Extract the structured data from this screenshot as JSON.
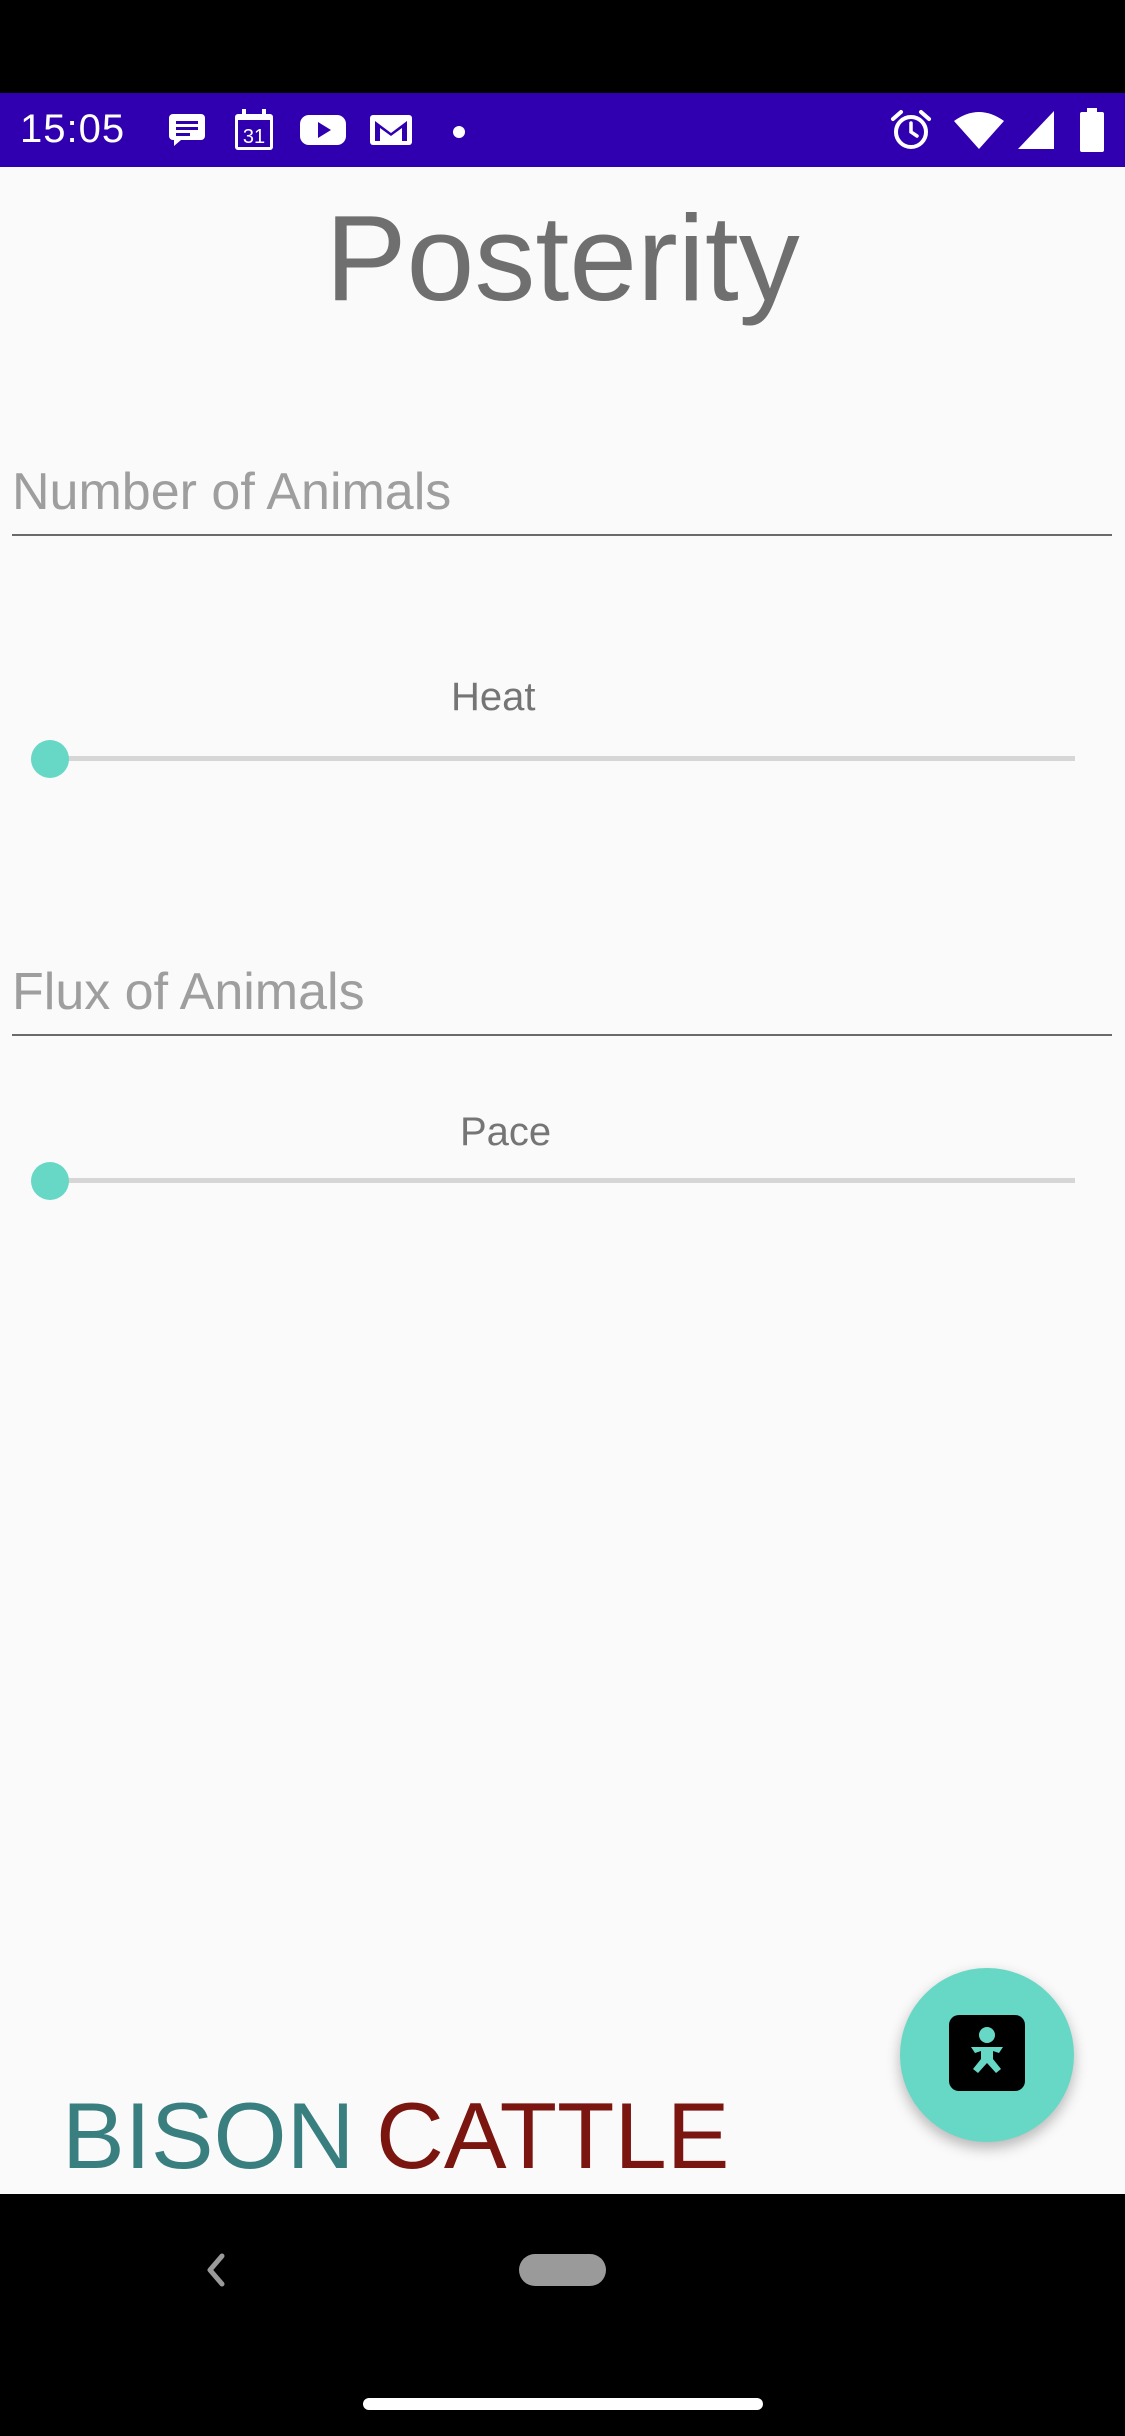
{
  "status_bar": {
    "time": "15:05",
    "icons": [
      "message-icon",
      "calendar-icon",
      "youtube-icon",
      "gmail-icon",
      "dot-icon",
      "alarm-icon",
      "wifi-icon",
      "signal-icon",
      "battery-icon"
    ],
    "calendar_day": "31",
    "background": "#3000b0"
  },
  "app": {
    "title": "Posterity",
    "number_field": {
      "placeholder": "Number of Animals",
      "value": ""
    },
    "heat_slider": {
      "label": "Heat",
      "value": 0
    },
    "flux_field": {
      "placeholder": "Flux of Animals",
      "value": ""
    },
    "pace_slider": {
      "label": "Pace",
      "value": 0
    },
    "fab": {
      "icon": "baby-icon",
      "color": "#66d8c5"
    },
    "bison_label": "BISON",
    "cattle_label": "CATTLE",
    "colors": {
      "bison": "#3a7f80",
      "cattle": "#7a1510",
      "accent": "#66d8c5"
    }
  },
  "nav_bar": {
    "icons": [
      "back-icon",
      "home-pill"
    ]
  }
}
